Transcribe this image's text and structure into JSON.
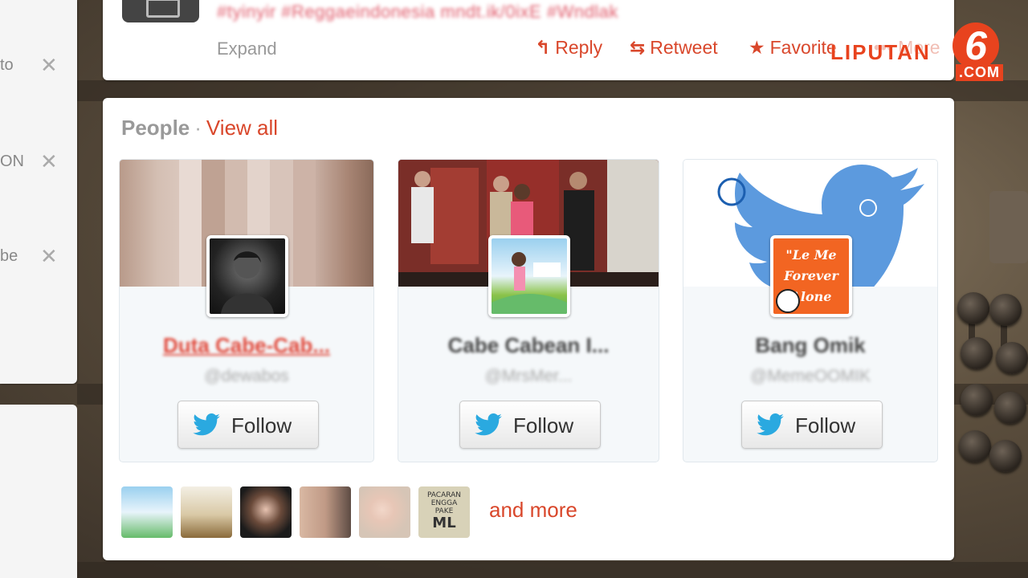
{
  "sidebar": {
    "items": [
      {
        "text": "to"
      },
      {
        "text": "ON"
      },
      {
        "text": "be"
      }
    ],
    "close_glyph": "✕"
  },
  "tweet": {
    "text": "#tyinyir #Reggaeindonesia mndt.ik/0ixE #Wndlak",
    "expand_label": "Expand",
    "actions": {
      "reply": "Reply",
      "retweet": "Retweet",
      "favorite": "Favorite",
      "more": "More"
    }
  },
  "watermark": {
    "brand": "LIPUTAN",
    "number": "6",
    "domain": ".COM"
  },
  "people": {
    "title": "People",
    "separator": "·",
    "view_all": "View all",
    "cards": [
      {
        "name": "Duta Cabe-Cab...",
        "handle": "@dewabos",
        "follow_label": "Follow"
      },
      {
        "name": "Cabe Cabean I...",
        "handle": "@MrsMer...",
        "follow_label": "Follow"
      },
      {
        "name": "Bang Omik",
        "handle": "@MemeOOMIK",
        "follow_label": "Follow",
        "avatar_text": "\"Le Me Forever Alone"
      }
    ],
    "more_label": "and more",
    "thumbs_note": "",
    "thumb_text": [
      "PACARAN",
      "ENGGA",
      "PAKE",
      "ML"
    ]
  },
  "colors": {
    "accent": "#d9472b",
    "twitter_blue": "#2aa9e0",
    "card_bg": "#f5f8fa"
  }
}
